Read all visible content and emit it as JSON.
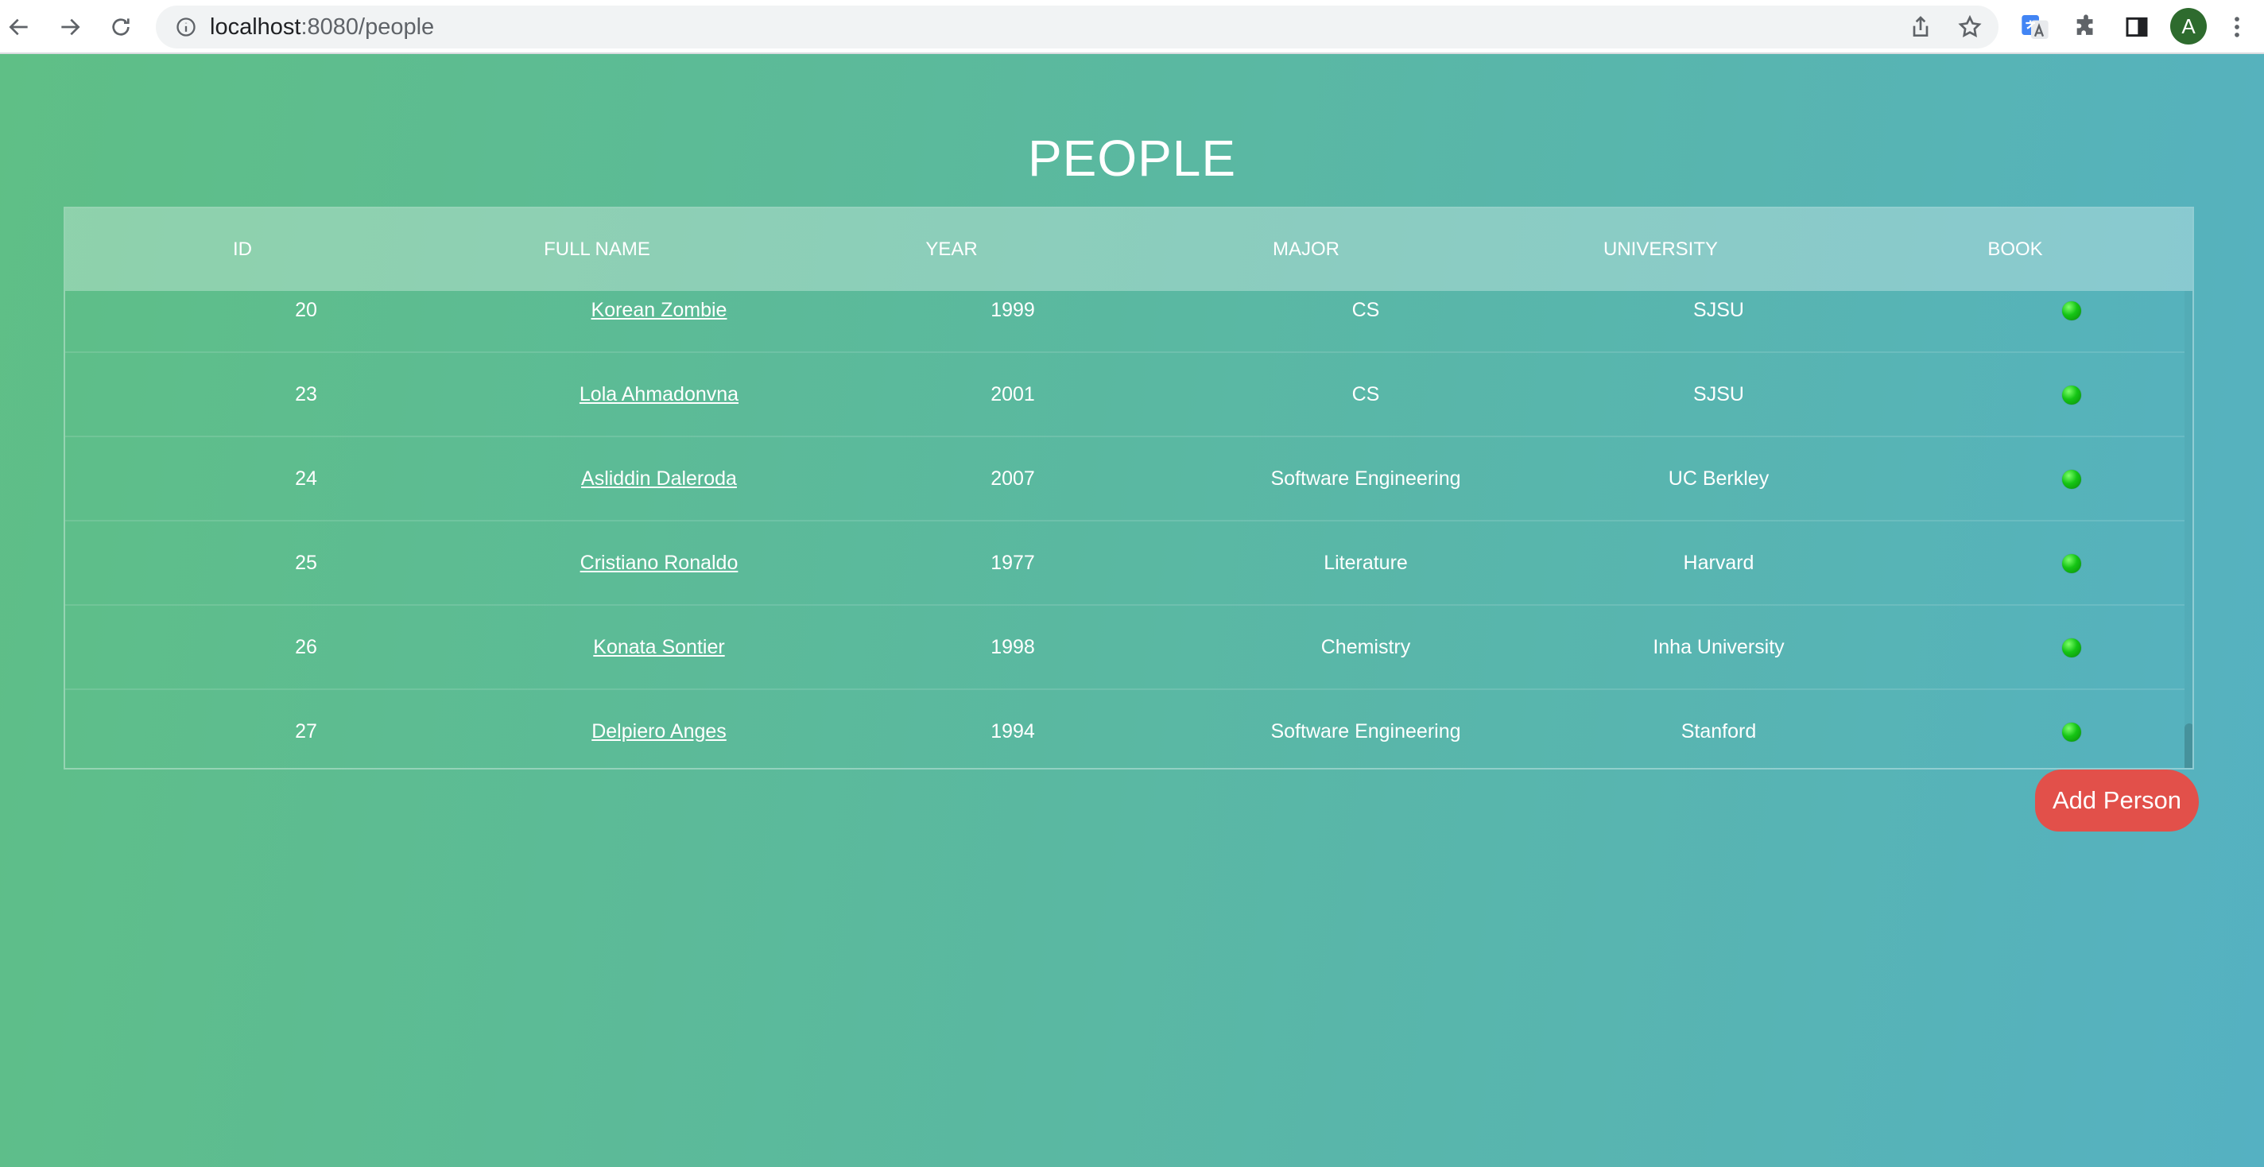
{
  "browser": {
    "url_host": "localhost",
    "url_rest": ":8080/people",
    "profile_initial": "A"
  },
  "page": {
    "title": "PEOPLE",
    "add_button_label": "Add Person"
  },
  "table": {
    "columns": [
      "ID",
      "FULL NAME",
      "YEAR",
      "MAJOR",
      "UNIVERSITY",
      "BOOK"
    ],
    "rows": [
      {
        "id": "20",
        "name": "Korean Zombie",
        "year": "1999",
        "major": "CS",
        "university": "SJSU",
        "book": true
      },
      {
        "id": "23",
        "name": "Lola Ahmadonvna",
        "year": "2001",
        "major": "CS",
        "university": "SJSU",
        "book": true
      },
      {
        "id": "24",
        "name": "Asliddin Daleroda",
        "year": "2007",
        "major": "Software Engineering",
        "university": "UC Berkley",
        "book": true
      },
      {
        "id": "25",
        "name": "Cristiano Ronaldo",
        "year": "1977",
        "major": "Literature",
        "university": "Harvard",
        "book": true
      },
      {
        "id": "26",
        "name": "Konata Sontier",
        "year": "1998",
        "major": "Chemistry",
        "university": "Inha University",
        "book": true
      },
      {
        "id": "27",
        "name": "Delpiero Anges",
        "year": "1994",
        "major": "Software Engineering",
        "university": "Stanford",
        "book": true
      }
    ]
  },
  "colors": {
    "accent_button": "#e2504a",
    "status_dot": "#15c515"
  }
}
